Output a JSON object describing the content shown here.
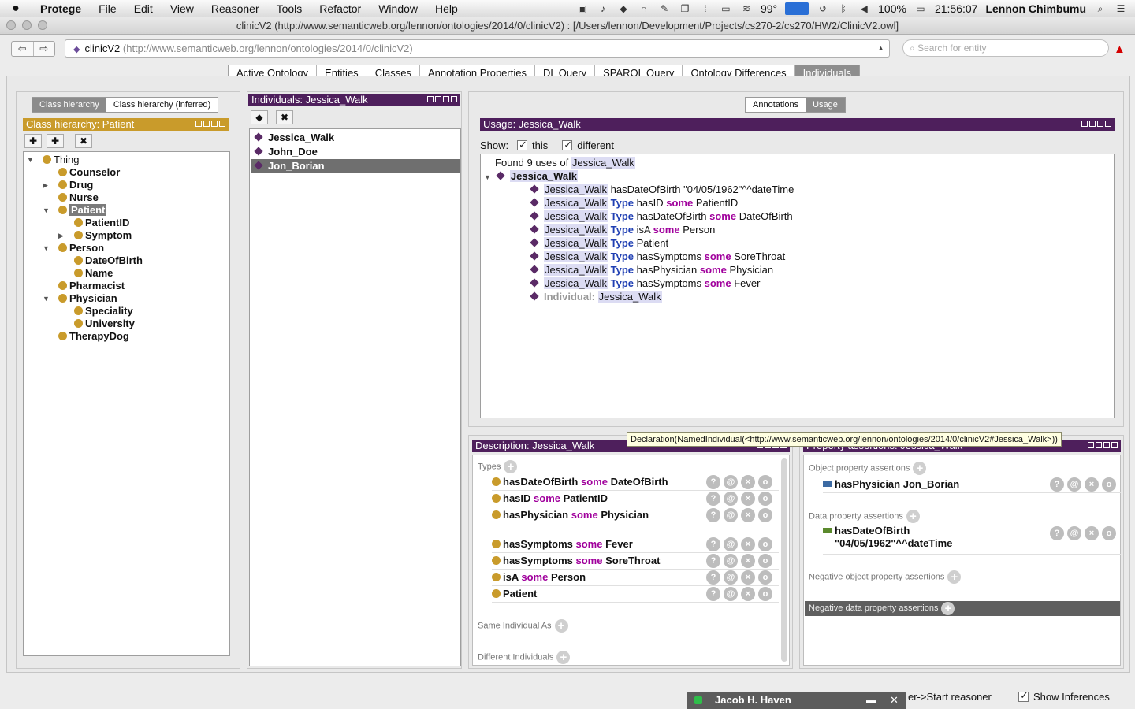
{
  "menubar": {
    "apple": "",
    "app": "Protege",
    "menus": [
      "File",
      "Edit",
      "View",
      "Reasoner",
      "Tools",
      "Refactor",
      "Window",
      "Help"
    ],
    "temp": "99°",
    "battery": "100%",
    "time": "21:56:07",
    "user": "Lennon Chimbumu"
  },
  "window": {
    "title": "clinicV2 (http://www.semanticweb.org/lennon/ontologies/2014/0/clinicV2)  : [/Users/lennon/Development/Projects/cs270-2/cs270/HW2/ClinicV2.owl]"
  },
  "nav": {
    "ontology_name": "clinicV2",
    "ontology_iri": "(http://www.semanticweb.org/lennon/ontologies/2014/0/clinicV2)",
    "search_placeholder": "Search for entity"
  },
  "tabs": [
    {
      "label": "Active Ontology",
      "active": false
    },
    {
      "label": "Entities",
      "active": false
    },
    {
      "label": "Classes",
      "active": false
    },
    {
      "label": "Annotation Properties",
      "active": false
    },
    {
      "label": "DL Query",
      "active": false
    },
    {
      "label": "SPARQL Query",
      "active": false
    },
    {
      "label": "Ontology Differences",
      "active": false
    },
    {
      "label": "Individuals",
      "active": true
    }
  ],
  "class_panel": {
    "tab_asserted": "Class hierarchy",
    "tab_inferred": "Class hierarchy (inferred)",
    "header": "Class hierarchy: Patient",
    "tree": [
      {
        "label": "Thing",
        "level": 0,
        "toggle": "▼"
      },
      {
        "label": "Counselor",
        "level": 1,
        "toggle": ""
      },
      {
        "label": "Drug",
        "level": 1,
        "toggle": "▶"
      },
      {
        "label": "Nurse",
        "level": 1,
        "toggle": ""
      },
      {
        "label": "Patient",
        "level": 1,
        "toggle": "▼"
      },
      {
        "label": "PatientID",
        "level": 2,
        "toggle": ""
      },
      {
        "label": "Symptom",
        "level": 2,
        "toggle": "▶"
      },
      {
        "label": "Person",
        "level": 1,
        "toggle": "▼"
      },
      {
        "label": "DateOfBirth",
        "level": 2,
        "toggle": ""
      },
      {
        "label": "Name",
        "level": 2,
        "toggle": ""
      },
      {
        "label": "Pharmacist",
        "level": 1,
        "toggle": ""
      },
      {
        "label": "Physician",
        "level": 1,
        "toggle": "▼"
      },
      {
        "label": "Speciality",
        "level": 2,
        "toggle": ""
      },
      {
        "label": "University",
        "level": 2,
        "toggle": ""
      },
      {
        "label": "TherapyDog",
        "level": 1,
        "toggle": ""
      }
    ]
  },
  "individuals_panel": {
    "header": "Individuals: Jessica_Walk",
    "items": [
      "Jessica_Walk",
      "John_Doe",
      "Jon_Borian"
    ]
  },
  "usage_panel": {
    "tab_annotations": "Annotations",
    "tab_usage": "Usage",
    "header": "Usage: Jessica_Walk",
    "show_label": "Show:",
    "show_this": "this",
    "show_different": "different",
    "found_prefix": "Found 9 uses of",
    "subject": "Jessica_Walk",
    "root": "Jessica_Walk",
    "lines": [
      {
        "subject": "Jessica_Walk",
        "type": "",
        "prop": "hasDateOfBirth \"04/05/1962\"^^dateTime",
        "some": "",
        "filler": ""
      },
      {
        "subject": "Jessica_Walk",
        "type": "Type",
        "prop": "hasID",
        "some": "some",
        "filler": "PatientID"
      },
      {
        "subject": "Jessica_Walk",
        "type": "Type",
        "prop": "hasDateOfBirth",
        "some": "some",
        "filler": "DateOfBirth"
      },
      {
        "subject": "Jessica_Walk",
        "type": "Type",
        "prop": "isA",
        "some": "some",
        "filler": "Person"
      },
      {
        "subject": "Jessica_Walk",
        "type": "Type",
        "prop": "Patient",
        "some": "",
        "filler": ""
      },
      {
        "subject": "Jessica_Walk",
        "type": "Type",
        "prop": "hasSymptoms",
        "some": "some",
        "filler": "SoreThroat"
      },
      {
        "subject": "Jessica_Walk",
        "type": "Type",
        "prop": "hasPhysician",
        "some": "some",
        "filler": "Physician"
      },
      {
        "subject": "Jessica_Walk",
        "type": "Type",
        "prop": "hasSymptoms",
        "some": "some",
        "filler": "Fever"
      }
    ],
    "individual_label": "Individual:",
    "individual_value": "Jessica_Walk"
  },
  "tooltip": "Declaration(NamedIndividual(<http://www.semanticweb.org/lennon/ontologies/2014/0/clinicV2#Jessica_Walk>))",
  "description_panel": {
    "header": "Description: Jessica_Walk",
    "types_label": "Types",
    "types": [
      {
        "prop": "hasDateOfBirth",
        "some": "some",
        "filler": "DateOfBirth"
      },
      {
        "prop": "hasID",
        "some": "some",
        "filler": "PatientID"
      },
      {
        "prop": "hasPhysician",
        "some": "some",
        "filler": "Physician"
      },
      {
        "prop": "hasSymptoms",
        "some": "some",
        "filler": "Fever"
      },
      {
        "prop": "hasSymptoms",
        "some": "some",
        "filler": "SoreThroat"
      },
      {
        "prop": "isA",
        "some": "some",
        "filler": "Person"
      },
      {
        "prop": "Patient",
        "some": "",
        "filler": ""
      }
    ],
    "same_label": "Same Individual As",
    "different_label": "Different Individuals"
  },
  "property_panel": {
    "header": "Property assertions: Jessica_Walk",
    "object_label": "Object property assertions",
    "object_assertion": "hasPhysician  Jon_Borian",
    "data_label": "Data property assertions",
    "data_assertion_line1": "hasDateOfBirth",
    "data_assertion_line2": "\"04/05/1962\"^^dateTime",
    "neg_object_label": "Negative object property assertions",
    "neg_data_label": "Negative data property assertions"
  },
  "bottom": {
    "reasoner_hint": "er->Start reasoner",
    "show_inferences": "Show Inferences",
    "chat_name": "Jacob H. Haven"
  }
}
